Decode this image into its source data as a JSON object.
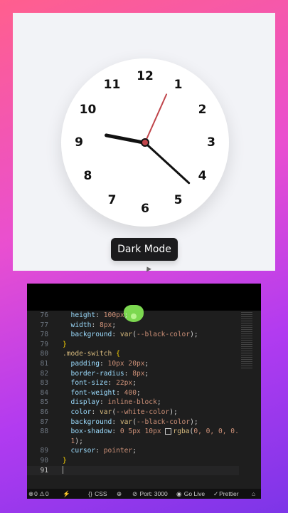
{
  "clock": {
    "numbers": [
      "12",
      "1",
      "2",
      "3",
      "4",
      "5",
      "6",
      "7",
      "8",
      "9",
      "10",
      "11"
    ],
    "time": {
      "hour": 9,
      "minute": 22,
      "second": 4
    }
  },
  "mode_button": {
    "label": "Dark Mode"
  },
  "editor": {
    "lines": [
      {
        "num": "76",
        "tokens": [
          [
            "p",
            "  height"
          ],
          [
            "w",
            ": "
          ],
          [
            "v",
            "100px"
          ],
          [
            "w",
            ";"
          ]
        ]
      },
      {
        "num": "77",
        "tokens": [
          [
            "p",
            "  width"
          ],
          [
            "w",
            ": "
          ],
          [
            "v",
            "8px"
          ],
          [
            "w",
            ";"
          ]
        ]
      },
      {
        "num": "78",
        "tokens": [
          [
            "p",
            "  background"
          ],
          [
            "w",
            ": "
          ],
          [
            "s",
            "var"
          ],
          [
            "w",
            "("
          ],
          [
            "v",
            "--black-color"
          ],
          [
            "w",
            ");"
          ]
        ]
      },
      {
        "num": "79",
        "tokens": [
          [
            "b",
            "}"
          ]
        ]
      },
      {
        "num": "80",
        "tokens": [
          [
            "s",
            ".mode-switch"
          ],
          [
            "w",
            " "
          ],
          [
            "b",
            "{"
          ]
        ]
      },
      {
        "num": "81",
        "tokens": [
          [
            "p",
            "  padding"
          ],
          [
            "w",
            ": "
          ],
          [
            "v",
            "10px 20px"
          ],
          [
            "w",
            ";"
          ]
        ]
      },
      {
        "num": "82",
        "tokens": [
          [
            "p",
            "  border-radius"
          ],
          [
            "w",
            ": "
          ],
          [
            "v",
            "8px"
          ],
          [
            "w",
            ";"
          ]
        ]
      },
      {
        "num": "83",
        "tokens": [
          [
            "p",
            "  font-size"
          ],
          [
            "w",
            ": "
          ],
          [
            "v",
            "22px"
          ],
          [
            "w",
            ";"
          ]
        ]
      },
      {
        "num": "84",
        "tokens": [
          [
            "p",
            "  font-weight"
          ],
          [
            "w",
            ": "
          ],
          [
            "v",
            "400"
          ],
          [
            "w",
            ";"
          ]
        ]
      },
      {
        "num": "85",
        "tokens": [
          [
            "p",
            "  display"
          ],
          [
            "w",
            ": "
          ],
          [
            "v",
            "inline-block"
          ],
          [
            "w",
            ";"
          ]
        ]
      },
      {
        "num": "86",
        "tokens": [
          [
            "p",
            "  color"
          ],
          [
            "w",
            ": "
          ],
          [
            "s",
            "var"
          ],
          [
            "w",
            "("
          ],
          [
            "v",
            "--white-color"
          ],
          [
            "w",
            ");"
          ]
        ]
      },
      {
        "num": "87",
        "tokens": [
          [
            "p",
            "  background"
          ],
          [
            "w",
            ": "
          ],
          [
            "s",
            "var"
          ],
          [
            "w",
            "("
          ],
          [
            "v",
            "--black-color"
          ],
          [
            "w",
            ");"
          ]
        ]
      },
      {
        "num": "88",
        "tokens": [
          [
            "p",
            "  box-shadow"
          ],
          [
            "w",
            ": "
          ],
          [
            "v",
            "0 5px 10px "
          ],
          [
            "sw",
            ""
          ],
          [
            "s",
            "rgba"
          ],
          [
            "w",
            "("
          ],
          [
            "v",
            "0, 0, 0, 0."
          ]
        ]
      },
      {
        "num": "",
        "tokens": [
          [
            "v",
            "  1"
          ],
          [
            "w",
            ");"
          ]
        ]
      },
      {
        "num": "89",
        "tokens": [
          [
            "p",
            "  cursor"
          ],
          [
            "w",
            ": "
          ],
          [
            "v",
            "pointer"
          ],
          [
            "w",
            ";"
          ]
        ]
      },
      {
        "num": "90",
        "tokens": [
          [
            "b",
            "}"
          ]
        ]
      },
      {
        "num": "91",
        "tokens": [
          [
            "caret",
            ""
          ]
        ],
        "selected": true
      }
    ]
  },
  "statusbar": {
    "errors": "0",
    "warnings": "0",
    "language": "CSS",
    "port": "Port: 3000",
    "golive": "Go Live",
    "prettier": "Prettier"
  }
}
